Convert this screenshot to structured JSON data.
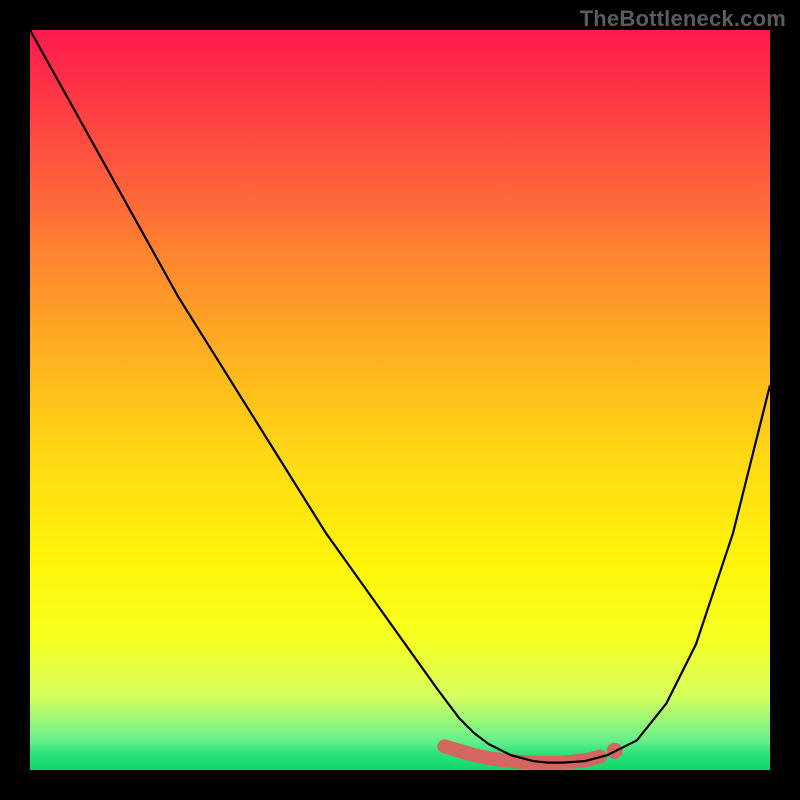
{
  "watermark": "TheBottleneck.com",
  "colors": {
    "background": "#000000",
    "curve": "#000000",
    "accent": "#d5655f",
    "gradient_top": "#ff1a4d",
    "gradient_bottom": "#0fd86a"
  },
  "chart_data": {
    "type": "line",
    "title": "",
    "subtitle": "",
    "xlabel": "",
    "ylabel": "",
    "xlim": [
      0,
      100
    ],
    "ylim": [
      0,
      100
    ],
    "grid": false,
    "legend": false,
    "annotations": [],
    "series": [
      {
        "name": "bottleneck-curve",
        "x": [
          0,
          5,
          10,
          15,
          20,
          25,
          30,
          35,
          40,
          45,
          50,
          55,
          58,
          60,
          62,
          65,
          68,
          70,
          72,
          75,
          78,
          82,
          86,
          90,
          95,
          100
        ],
        "values": [
          100,
          91,
          82,
          73,
          64,
          56,
          48,
          40,
          32,
          25,
          18,
          11,
          7,
          5,
          3.5,
          2,
          1.2,
          1,
          1,
          1.2,
          2,
          4,
          9,
          17,
          32,
          52
        ]
      }
    ],
    "accent_band": {
      "name": "optimal-range",
      "x": [
        56,
        58,
        60,
        62,
        65,
        68,
        70,
        72,
        75,
        77
      ],
      "values": [
        3.2,
        2.6,
        2.0,
        1.6,
        1.2,
        1.0,
        1.0,
        1.0,
        1.3,
        1.8
      ]
    },
    "accent_dot": {
      "x": 79,
      "value": 2.6
    }
  }
}
